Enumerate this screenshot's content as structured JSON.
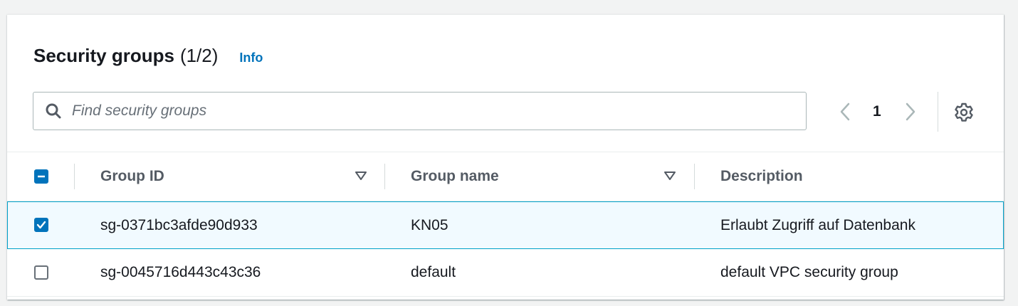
{
  "header": {
    "title": "Security groups",
    "count": "(1/2)",
    "info_label": "Info"
  },
  "search": {
    "placeholder": "Find security groups",
    "value": ""
  },
  "pagination": {
    "current_page": "1"
  },
  "table": {
    "columns": [
      "Group ID",
      "Group name",
      "Description"
    ],
    "rows": [
      {
        "selected": true,
        "group_id": "sg-0371bc3afde90d933",
        "group_name": "KN05",
        "description": "Erlaubt Zugriff auf Datenbank"
      },
      {
        "selected": false,
        "group_id": "sg-0045716d443c43c36",
        "group_name": "default",
        "description": "default VPC security group"
      }
    ]
  },
  "icons": [
    "search-icon",
    "chevron-left-icon",
    "chevron-right-icon",
    "gear-icon",
    "sort-icon",
    "checkbox-indeterminate-icon",
    "checkmark-icon"
  ],
  "colors": {
    "accent": "#0073bb",
    "selected_row_bg": "#f1faff",
    "selected_row_border": "#00a1c9",
    "text": "#16191f",
    "muted": "#545b64"
  }
}
